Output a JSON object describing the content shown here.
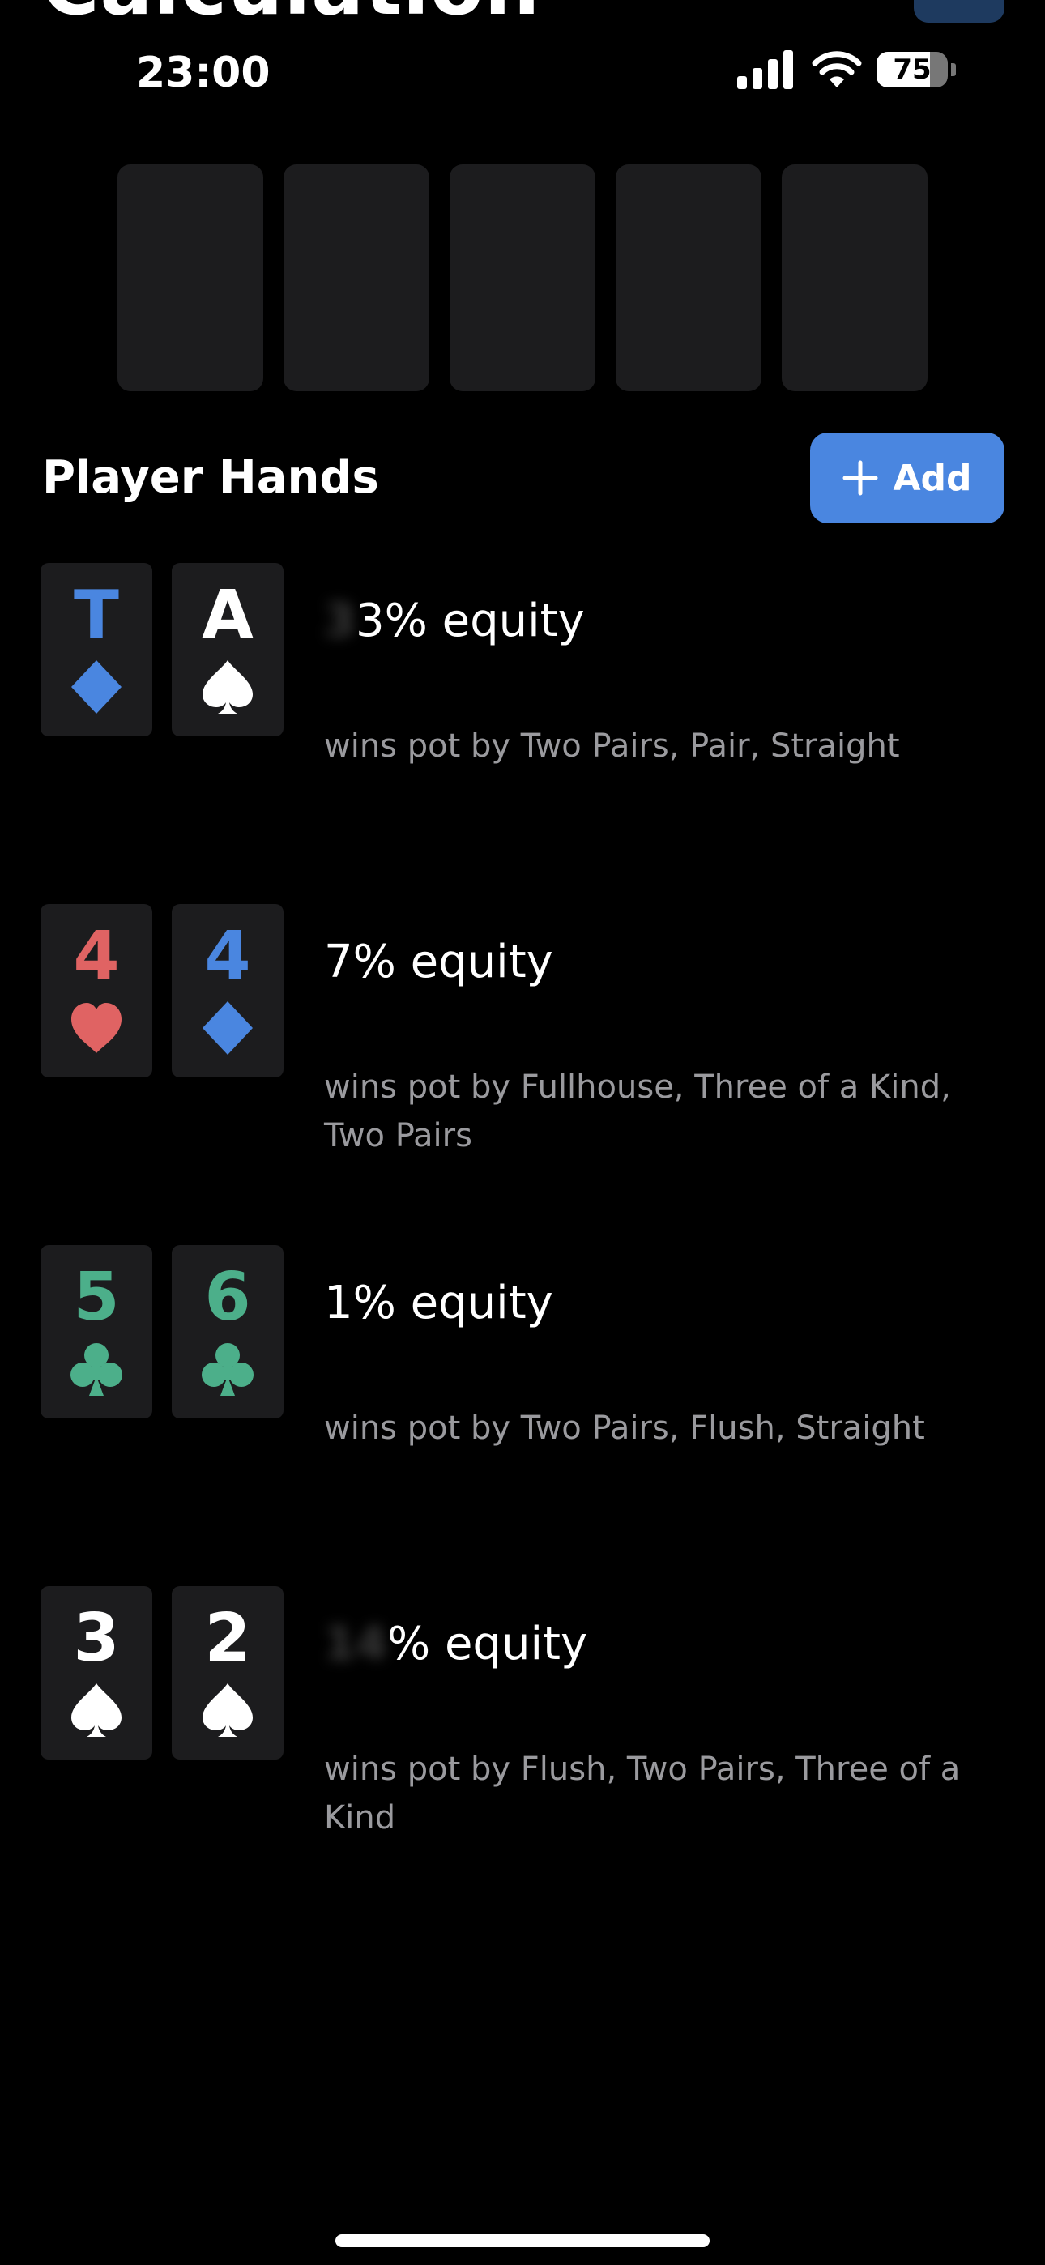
{
  "header": {
    "title": "Calculation"
  },
  "status_bar": {
    "time": "23:00",
    "battery": 75,
    "icons": [
      "cellular-signal-icon",
      "wifi-icon",
      "battery-icon"
    ]
  },
  "board": {
    "slots": 5
  },
  "player_hands": {
    "title": "Player Hands",
    "add_label": "Add",
    "hands": [
      {
        "cards": [
          {
            "rank": "T",
            "suit": "diamond",
            "color": "#4a86e0"
          },
          {
            "rank": "A",
            "suit": "spade",
            "color": "#ffffff"
          }
        ],
        "equity_label": "3.  .3% equity",
        "equity_hidden": "3",
        "equity_visible": "3% equity",
        "wins": "wins pot by Two Pairs, Pair, Straight"
      },
      {
        "cards": [
          {
            "rank": "4",
            "suit": "heart",
            "color": "#e06363"
          },
          {
            "rank": "4",
            "suit": "diamond",
            "color": "#4a86e0"
          }
        ],
        "equity_label": "7% equity",
        "equity_hidden": "",
        "equity_visible": "7% equity",
        "wins": "wins pot by Fullhouse, Three of a Kind, Two Pairs"
      },
      {
        "cards": [
          {
            "rank": "5",
            "suit": "club",
            "color": "#4caf8a"
          },
          {
            "rank": "6",
            "suit": "club",
            "color": "#4caf8a"
          }
        ],
        "equity_label": "1% equity",
        "equity_hidden": "",
        "equity_visible": "1% equity",
        "wins": "wins pot by Two Pairs, Flush, Straight"
      },
      {
        "cards": [
          {
            "rank": "3",
            "suit": "spade",
            "color": "#ffffff"
          },
          {
            "rank": "2",
            "suit": "spade",
            "color": "#ffffff"
          }
        ],
        "equity_label": "14  % equity",
        "equity_hidden": "14",
        "equity_visible": "% equity",
        "wins": "wins pot by Flush, Two Pairs, Three of a Kind"
      }
    ]
  },
  "colors": {
    "background": "#000000",
    "card": "#1c1c1e",
    "accent": "#4a86e0",
    "muted_text": "#9a9a9e"
  }
}
